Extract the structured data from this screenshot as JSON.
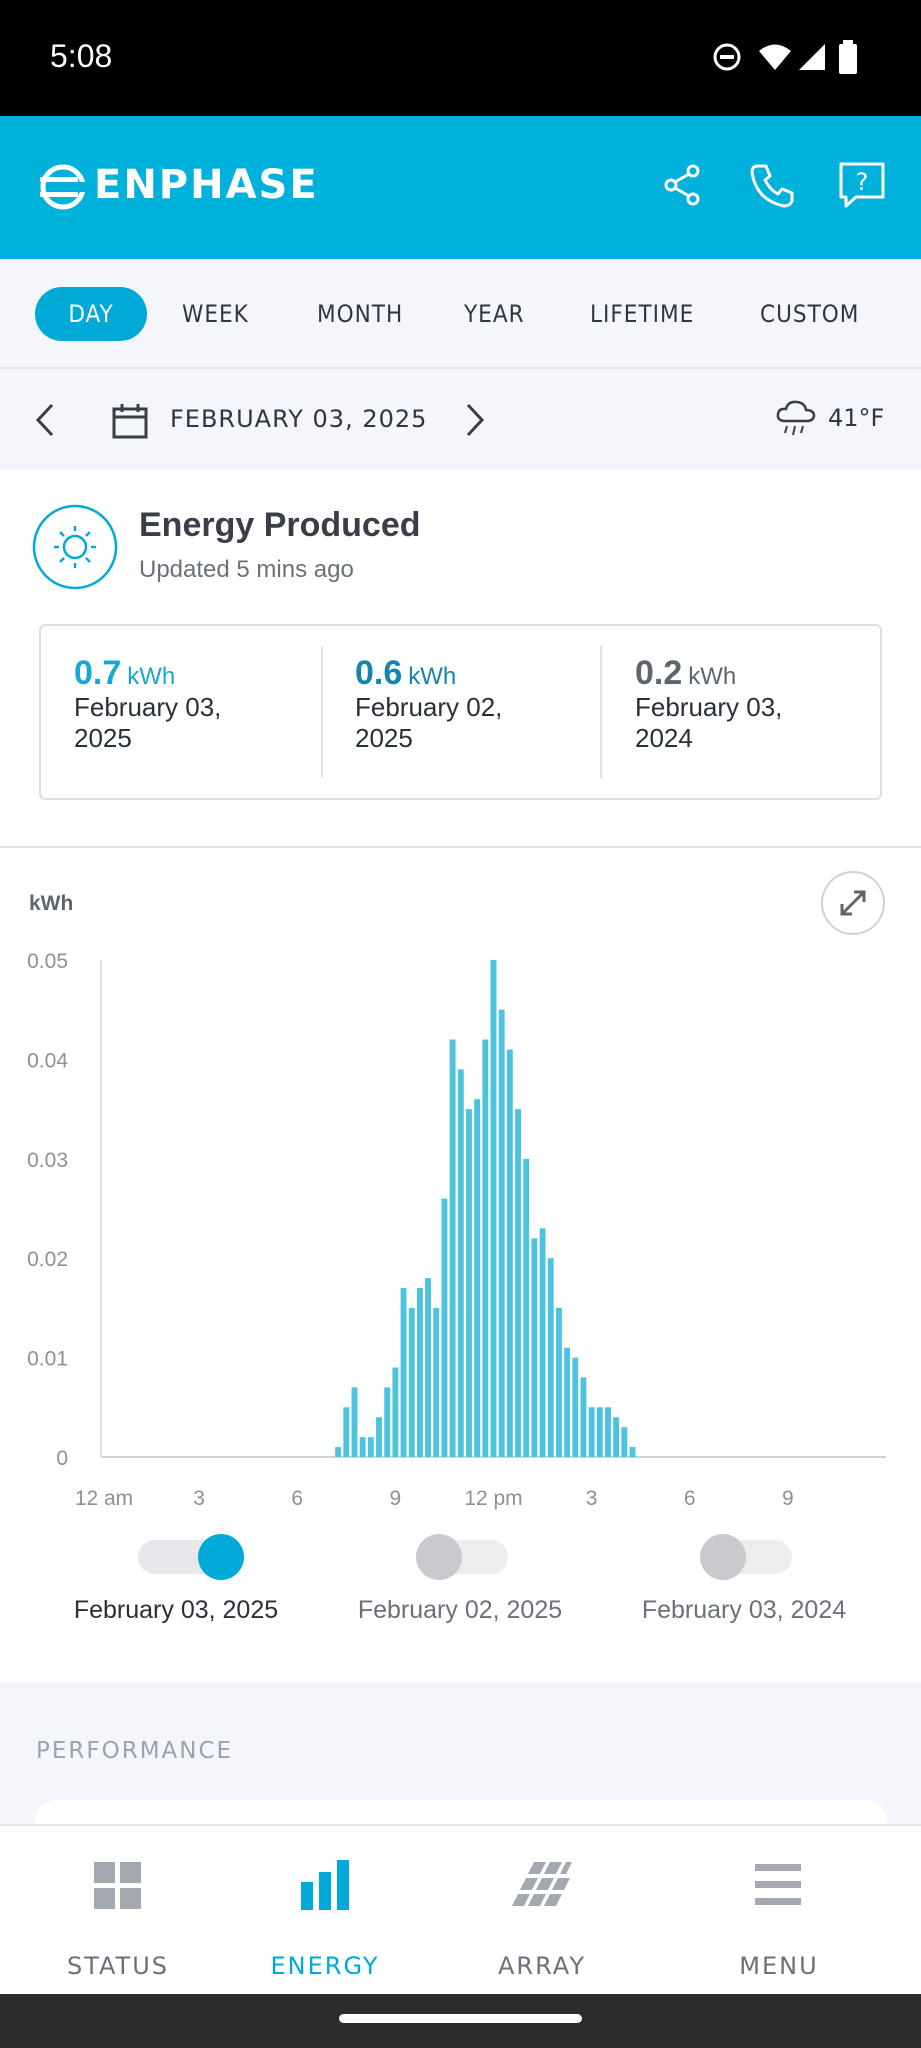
{
  "status_bar": {
    "time": "5:08"
  },
  "app_bar": {
    "brand": "ENPHASE"
  },
  "tabs": [
    {
      "label": "DAY",
      "active": true
    },
    {
      "label": "WEEK",
      "active": false
    },
    {
      "label": "MONTH",
      "active": false
    },
    {
      "label": "YEAR",
      "active": false
    },
    {
      "label": "LIFETIME",
      "active": false
    },
    {
      "label": "CUSTOM",
      "active": false
    }
  ],
  "date_bar": {
    "date": "FEBRUARY 03, 2025",
    "weather_temp": "41°F"
  },
  "summary": {
    "title": "Energy Produced",
    "updated": "Updated 5 mins ago",
    "comparisons": [
      {
        "value": "0.7",
        "unit": "kWh",
        "date_line1": "February 03,",
        "date_line2": "2025",
        "color": "#1aa7d3"
      },
      {
        "value": "0.6",
        "unit": "kWh",
        "date_line1": "February 02,",
        "date_line2": "2025",
        "color": "#1586ab"
      },
      {
        "value": "0.2",
        "unit": "kWh",
        "date_line1": "February 03,",
        "date_line2": "2024",
        "color": "#5f656d"
      }
    ]
  },
  "chart_data": {
    "type": "bar",
    "ylabel": "kWh",
    "ylim": [
      0,
      0.05
    ],
    "y_ticks": [
      "0.05",
      "0.04",
      "0.03",
      "0.02",
      "0.01",
      "0"
    ],
    "x_ticks": [
      "12 am",
      "3",
      "6",
      "9",
      "12 pm",
      "3",
      "6",
      "9"
    ],
    "x_hours_start": 7.25,
    "x_step_hours": 0.25,
    "series": [
      {
        "color": "#4ec3e0",
        "values": [
          0.001,
          0.005,
          0.007,
          0.002,
          0.002,
          0.004,
          0.007,
          0.009,
          0.017,
          0.015,
          0.017,
          0.018,
          0.015,
          0.026,
          0.042,
          0.039,
          0.035,
          0.036,
          0.042,
          0.05,
          0.045,
          0.041,
          0.035,
          0.03,
          0.022,
          0.023,
          0.02,
          0.015,
          0.011,
          0.01,
          0.008,
          0.005,
          0.005,
          0.005,
          0.004,
          0.003,
          0.001
        ]
      }
    ]
  },
  "legend": [
    {
      "label": "February 03, 2025",
      "on": true
    },
    {
      "label": "February 02, 2025",
      "on": false
    },
    {
      "label": "February 03, 2024",
      "on": false
    }
  ],
  "performance": {
    "label": "PERFORMANCE"
  },
  "bottom_nav": [
    {
      "label": "STATUS",
      "icon": "grid-icon",
      "active": false
    },
    {
      "label": "ENERGY",
      "icon": "bar-chart-icon",
      "active": true
    },
    {
      "label": "ARRAY",
      "icon": "array-icon",
      "active": false
    },
    {
      "label": "MENU",
      "icon": "menu-icon",
      "active": false
    }
  ],
  "colors": {
    "accent": "#00b1db",
    "bar": "#4ec3e0"
  }
}
